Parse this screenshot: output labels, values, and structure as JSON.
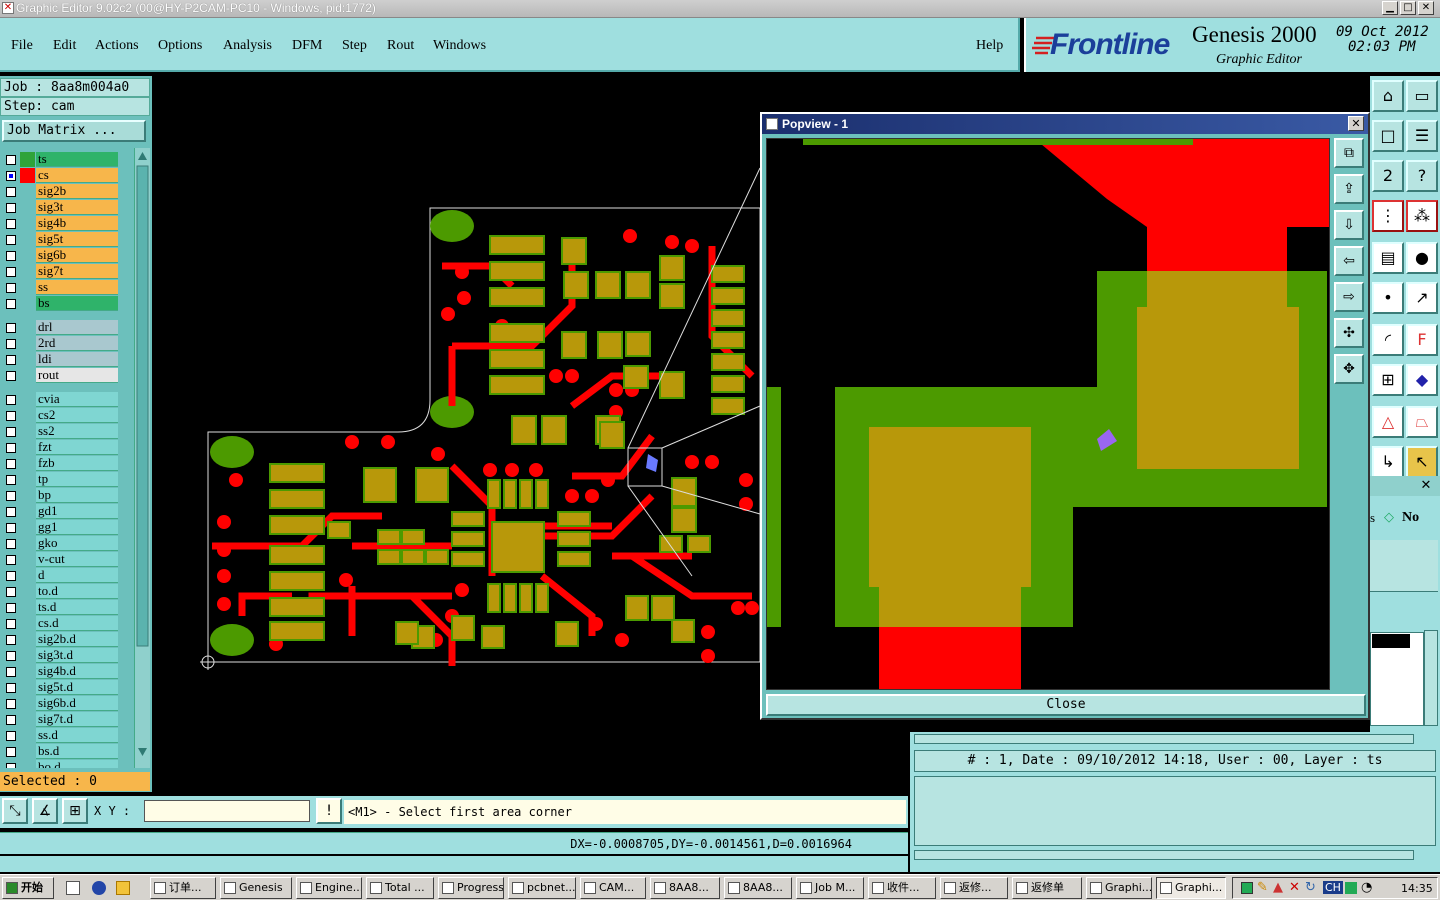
{
  "window": {
    "title": "Graphic Editor 9.02c2 (00@HY-P2CAM-PC10 - Windows, pid:1772)",
    "min_label": "▁",
    "max_label": "□",
    "close_label": "✕"
  },
  "menu": [
    "File",
    "Edit",
    "Actions",
    "Options",
    "Analysis",
    "DFM",
    "Step",
    "Rout",
    "Windows"
  ],
  "help_label": "Help",
  "brand": {
    "logo": "Frontline",
    "product": "Genesis 2000",
    "subtitle": "Graphic Editor",
    "date": "09 Oct 2012",
    "time": "02:03 PM"
  },
  "job": {
    "job_line": "Job : 8aa8m004a0",
    "step_line": "Step: cam",
    "matrix_button": "Job Matrix ..."
  },
  "layers": [
    {
      "name": "ts",
      "color": "#2fa33a",
      "bg": "#2fb36a",
      "active": false
    },
    {
      "name": "cs",
      "color": "#ff0000",
      "bg": "#f7b64b",
      "active": true
    },
    {
      "name": "sig2b",
      "color": "",
      "bg": "#f7b64b",
      "active": false
    },
    {
      "name": "sig3t",
      "color": "",
      "bg": "#f7b64b",
      "active": false
    },
    {
      "name": "sig4b",
      "color": "",
      "bg": "#f7b64b",
      "active": false
    },
    {
      "name": "sig5t",
      "color": "",
      "bg": "#f7b64b",
      "active": false
    },
    {
      "name": "sig6b",
      "color": "",
      "bg": "#f7b64b",
      "active": false
    },
    {
      "name": "sig7t",
      "color": "",
      "bg": "#f7b64b",
      "active": false
    },
    {
      "name": "ss",
      "color": "",
      "bg": "#f7b64b",
      "active": false
    },
    {
      "name": "bs",
      "color": "",
      "bg": "#2fb36a",
      "active": false
    },
    {
      "name": "drl",
      "color": "",
      "bg": "#a9c8cf",
      "active": false
    },
    {
      "name": "2rd",
      "color": "",
      "bg": "#a9c8cf",
      "active": false
    },
    {
      "name": "ldi",
      "color": "",
      "bg": "#a9c8cf",
      "active": false
    },
    {
      "name": "rout",
      "color": "",
      "bg": "#e6e6e6",
      "active": false
    },
    {
      "name": "cvia",
      "color": "",
      "bg": "#7fd6d2",
      "active": false
    },
    {
      "name": "cs2",
      "color": "",
      "bg": "#7fd6d2",
      "active": false
    },
    {
      "name": "ss2",
      "color": "",
      "bg": "#7fd6d2",
      "active": false
    },
    {
      "name": "fzt",
      "color": "",
      "bg": "#7fd6d2",
      "active": false
    },
    {
      "name": "fzb",
      "color": "",
      "bg": "#7fd6d2",
      "active": false
    },
    {
      "name": "tp",
      "color": "",
      "bg": "#7fd6d2",
      "active": false
    },
    {
      "name": "bp",
      "color": "",
      "bg": "#7fd6d2",
      "active": false
    },
    {
      "name": "gd1",
      "color": "",
      "bg": "#7fd6d2",
      "active": false
    },
    {
      "name": "gg1",
      "color": "",
      "bg": "#7fd6d2",
      "active": false
    },
    {
      "name": "gko",
      "color": "",
      "bg": "#7fd6d2",
      "active": false
    },
    {
      "name": "v-cut",
      "color": "",
      "bg": "#7fd6d2",
      "active": false
    },
    {
      "name": "d",
      "color": "",
      "bg": "#7fd6d2",
      "active": false
    },
    {
      "name": "to.d",
      "color": "",
      "bg": "#7fd6d2",
      "active": false
    },
    {
      "name": "ts.d",
      "color": "",
      "bg": "#7fd6d2",
      "active": false
    },
    {
      "name": "cs.d",
      "color": "",
      "bg": "#7fd6d2",
      "active": false
    },
    {
      "name": "sig2b.d",
      "color": "",
      "bg": "#7fd6d2",
      "active": false
    },
    {
      "name": "sig3t.d",
      "color": "",
      "bg": "#7fd6d2",
      "active": false
    },
    {
      "name": "sig4b.d",
      "color": "",
      "bg": "#7fd6d2",
      "active": false
    },
    {
      "name": "sig5t.d",
      "color": "",
      "bg": "#7fd6d2",
      "active": false
    },
    {
      "name": "sig6b.d",
      "color": "",
      "bg": "#7fd6d2",
      "active": false
    },
    {
      "name": "sig7t.d",
      "color": "",
      "bg": "#7fd6d2",
      "active": false
    },
    {
      "name": "ss.d",
      "color": "",
      "bg": "#7fd6d2",
      "active": false
    },
    {
      "name": "bs.d",
      "color": "",
      "bg": "#7fd6d2",
      "active": false
    },
    {
      "name": "bo.d",
      "color": "",
      "bg": "#7fd6d2",
      "active": false
    }
  ],
  "selected_label": "Selected : 0",
  "xy_label": "X Y :",
  "xy_value": "",
  "prompt": "<M1> - Select first area corner",
  "dx_readout": "DX=-0.0008705,DY=-0.0014561,D=0.0016964",
  "popview": {
    "title": "Popview - 1",
    "close_button": "Close"
  },
  "right_panel": {
    "no_option": "No",
    "s_label": "s"
  },
  "log_info": "# : 1, Date : 09/10/2012 14:18, User : 00, Layer : ts",
  "colors": {
    "pcb_green": "#4c9a00",
    "pcb_pad": "#b8980a",
    "pcb_red": "#ff0000",
    "ui_cyan": "#9fdfdf"
  },
  "taskbar": {
    "start": "开始",
    "tasks": [
      "订单...",
      "Genesis",
      "Engine...",
      "Total ...",
      "Progress",
      "pcbnet...",
      "CAM...",
      "8AA8...",
      "8AA8...",
      "Job M...",
      "收件...",
      "返修...",
      "返修单",
      "Graphi...",
      "Graphi..."
    ],
    "lang": "CH",
    "clock": "14:35"
  }
}
